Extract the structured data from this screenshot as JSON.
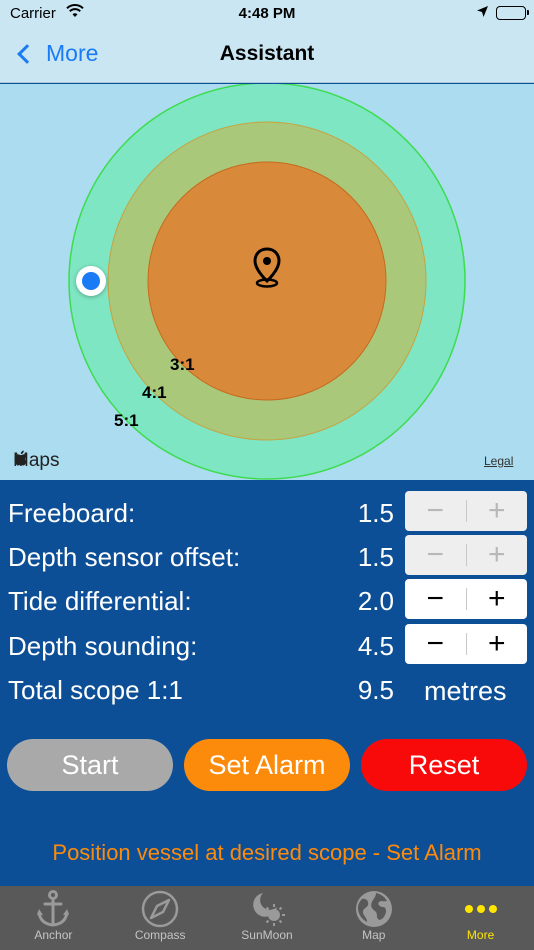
{
  "status_bar": {
    "carrier": "Carrier",
    "time": "4:48 PM"
  },
  "nav": {
    "back_label": "More",
    "title": "Assistant"
  },
  "map": {
    "scope_labels": [
      "3:1",
      "4:1",
      "5:1"
    ],
    "attribution": "Maps",
    "legal": "Legal",
    "zone_colors": {
      "outer": "#7ee6c3",
      "middle": "#a9c87a",
      "inner": "#d88a3a"
    }
  },
  "params": {
    "rows": [
      {
        "label": "Freeboard:",
        "value": "1.5",
        "enabled": false
      },
      {
        "label": "Depth sensor offset:",
        "value": "1.5",
        "enabled": false
      },
      {
        "label": "Tide differential:",
        "value": "2.0",
        "enabled": true
      },
      {
        "label": "Depth sounding:",
        "value": "4.5",
        "enabled": true
      }
    ],
    "total": {
      "label": "Total scope 1:1",
      "value": "9.5",
      "units": "metres"
    },
    "minus": "−",
    "plus": "+"
  },
  "actions": {
    "start": "Start",
    "set_alarm": "Set Alarm",
    "reset": "Reset"
  },
  "hint": "Position vessel at desired scope - Set Alarm",
  "tabs": [
    {
      "label": "Anchor",
      "icon": "anchor-icon"
    },
    {
      "label": "Compass",
      "icon": "compass-icon"
    },
    {
      "label": "SunMoon",
      "icon": "sunmoon-icon"
    },
    {
      "label": "Map",
      "icon": "globe-icon"
    },
    {
      "label": "More",
      "icon": "more-dots-icon",
      "active": true
    }
  ],
  "colors": {
    "accent": "#1a7bf5",
    "panel": "#0d4f97",
    "orange": "#fd8b0b",
    "red": "#f80a0a",
    "tab_active": "#ffe600"
  }
}
